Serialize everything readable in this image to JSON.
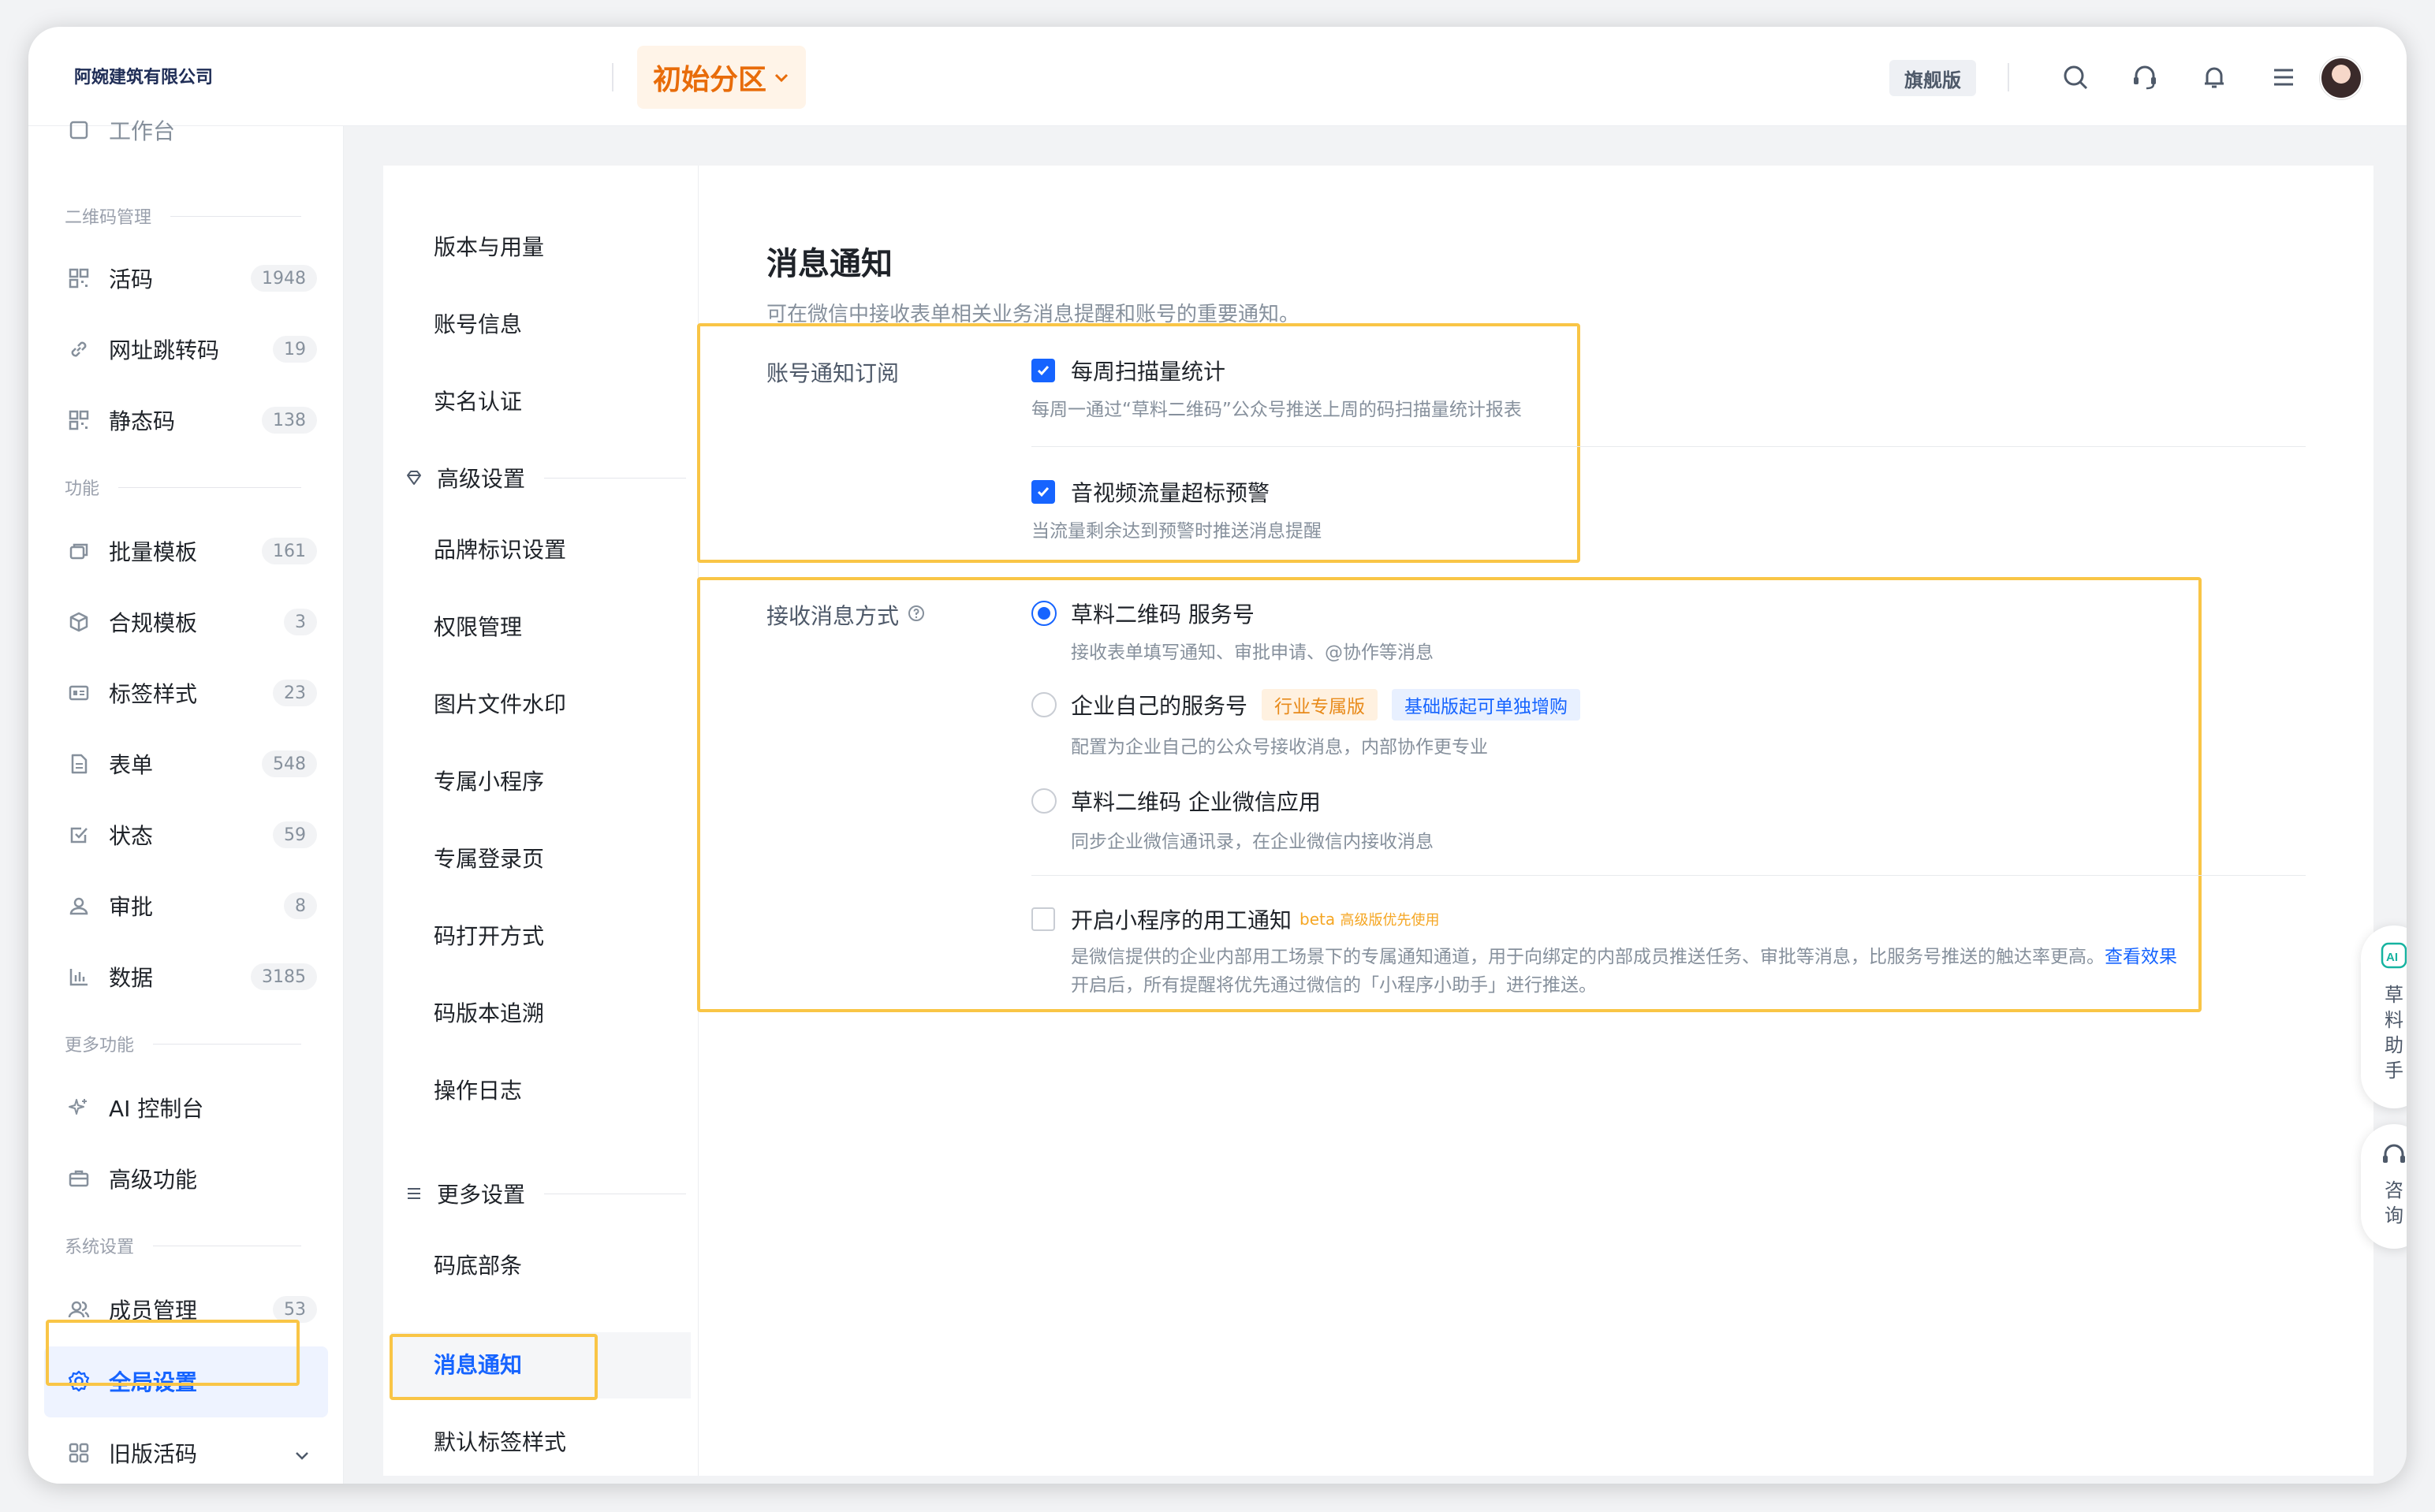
{
  "company": "阿婉建筑有限公司",
  "zone": "初始分区",
  "edition": "旗舰版",
  "sidebar": {
    "partial_top": "工作台",
    "sections": {
      "qr": "二维码管理",
      "func": "功能",
      "more": "更多功能",
      "sys": "系统设置"
    },
    "items": [
      {
        "label": "活码",
        "count": "1948"
      },
      {
        "label": "网址跳转码",
        "count": "19"
      },
      {
        "label": "静态码",
        "count": "138"
      },
      {
        "label": "批量模板",
        "count": "161"
      },
      {
        "label": "合规模板",
        "count": "3"
      },
      {
        "label": "标签样式",
        "count": "23"
      },
      {
        "label": "表单",
        "count": "548"
      },
      {
        "label": "状态",
        "count": "59"
      },
      {
        "label": "审批",
        "count": "8"
      },
      {
        "label": "数据",
        "count": "3185"
      },
      {
        "label": "AI 控制台"
      },
      {
        "label": "高级功能"
      },
      {
        "label": "成员管理",
        "count": "53"
      },
      {
        "label": "全局设置"
      },
      {
        "label": "旧版活码"
      }
    ]
  },
  "subnav": {
    "items_top": [
      "版本与用量",
      "账号信息",
      "实名认证"
    ],
    "group_advanced": "高级设置",
    "items_adv": [
      "品牌标识设置",
      "权限管理",
      "图片文件水印",
      "专属小程序",
      "专属登录页",
      "码打开方式",
      "码版本追溯",
      "操作日志"
    ],
    "group_more": "更多设置",
    "items_more": [
      "码底部条",
      "消息通知",
      "默认标签样式"
    ]
  },
  "main": {
    "title": "消息通知",
    "description": "可在微信中接收表单相关业务消息提醒和账号的重要通知。",
    "subscription": {
      "label": "账号通知订阅",
      "options": [
        {
          "title": "每周扫描量统计",
          "desc": "每周一通过“草料二维码”公众号推送上周的码扫描量统计报表",
          "checked": true
        },
        {
          "title": "音视频流量超标预警",
          "desc": "当流量剩余达到预警时推送消息提醒",
          "checked": true
        }
      ]
    },
    "receive": {
      "label": "接收消息方式",
      "options": [
        {
          "title": "草料二维码 服务号",
          "desc": "接收表单填写通知、审批申请、@协作等消息",
          "selected": true
        },
        {
          "title": "企业自己的服务号",
          "tag1": "行业专属版",
          "tag2": "基础版起可单独增购",
          "desc": "配置为企业自己的公众号接收消息，内部协作更专业",
          "selected": false
        },
        {
          "title": "草料二维码 企业微信应用",
          "desc": "同步企业微信通讯录，在企业微信内接收消息",
          "selected": false
        }
      ],
      "miniapp": {
        "title": "开启小程序的用工通知",
        "beta": "beta",
        "beta_note": "高级版优先使用",
        "desc1": "是微信提供的企业内部用工场景下的专属通知通道，用于向绑定的内部成员推送任务、审批等消息，比服务号推送的触达率更高。",
        "link": "查看效果",
        "desc2": "开启后，所有提醒将优先通过微信的「小程序小助手」进行推送。",
        "checked": false
      }
    }
  },
  "float": {
    "assistant": "草料助手",
    "consult": "咨询"
  },
  "colors": {
    "accent": "#1664ff",
    "zone_orange": "#e86c0a",
    "highlight": "#f9c546"
  }
}
